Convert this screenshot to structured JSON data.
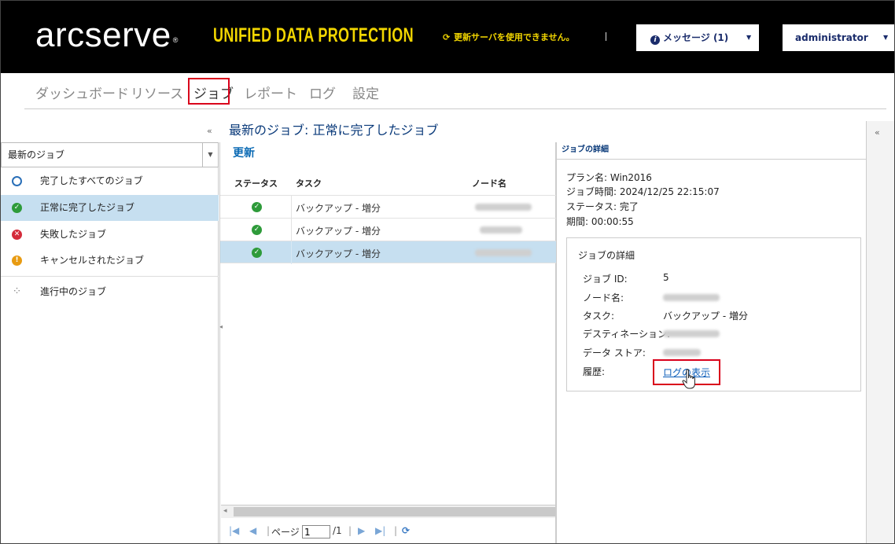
{
  "header": {
    "logo": "arcserve",
    "product": "UNIFIED DATA PROTECTION",
    "update_warning": "更新サーバを使用できません。",
    "messages_label": "メッセージ (1)",
    "user": "administrator"
  },
  "nav": [
    "ダッシュボード",
    "リソース",
    "ジョブ",
    "レポート",
    "ログ",
    "設定"
  ],
  "main": {
    "title": "最新のジョブ: 正常に完了したジョブ"
  },
  "sidebar": {
    "dropdown": "最新のジョブ",
    "items": [
      "完了したすべてのジョブ",
      "正常に完了したジョブ",
      "失敗したジョブ",
      "キャンセルされたジョブ",
      "進行中のジョブ"
    ]
  },
  "grid": {
    "refresh": "更新",
    "columns": [
      "ステータス",
      "タスク",
      "ノード名"
    ],
    "rows": [
      {
        "task": "バックアップ - 増分"
      },
      {
        "task": "バックアップ - 増分"
      },
      {
        "task": "バックアップ - 増分"
      }
    ]
  },
  "pager": {
    "page_label": "ページ",
    "page": "1",
    "total": "/1"
  },
  "detail": {
    "header": "ジョブの詳細",
    "plan": "プラン名: Win2016",
    "time": "ジョブ時間: 2024/12/25 22:15:07",
    "status": "ステータス: 完了",
    "duration": "期間: 00:00:55",
    "group_title": "ジョブの詳細",
    "fields": [
      {
        "label": "ジョブ ID:",
        "value": "5"
      },
      {
        "label": "ノード名:",
        "value": ""
      },
      {
        "label": "タスク:",
        "value": "バックアップ - 増分"
      },
      {
        "label": "デスティネーション:",
        "value": ""
      },
      {
        "label": "データ ストア:",
        "value": ""
      },
      {
        "label": "履歴:",
        "value": "ログの表示"
      }
    ]
  }
}
